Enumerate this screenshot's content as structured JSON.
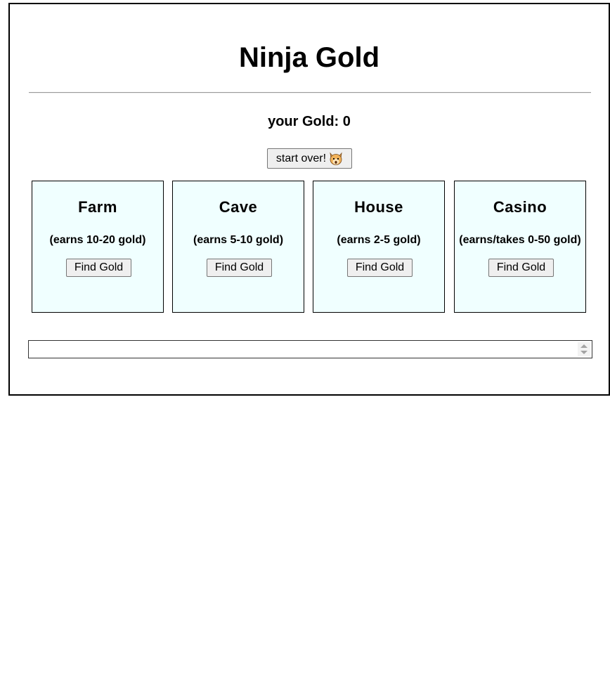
{
  "title": "Ninja Gold",
  "gold": {
    "label": "your Gold:",
    "value": "0"
  },
  "start_over": {
    "label": "start over!",
    "icon": "cat-face-icon"
  },
  "locations": [
    {
      "name": "Farm",
      "earns": "(earns 10-20 gold)",
      "button": "Find Gold"
    },
    {
      "name": "Cave",
      "earns": "(earns 5-10 gold)",
      "button": "Find Gold"
    },
    {
      "name": "House",
      "earns": "(earns 2-5 gold)",
      "button": "Find Gold"
    },
    {
      "name": "Casino",
      "earns": "(earns/takes 0-50 gold)",
      "button": "Find Gold"
    }
  ],
  "activity_log": {
    "value": ""
  },
  "colors": {
    "box_background": "#f0ffff",
    "border": "#000000",
    "button_background": "#efefef"
  }
}
